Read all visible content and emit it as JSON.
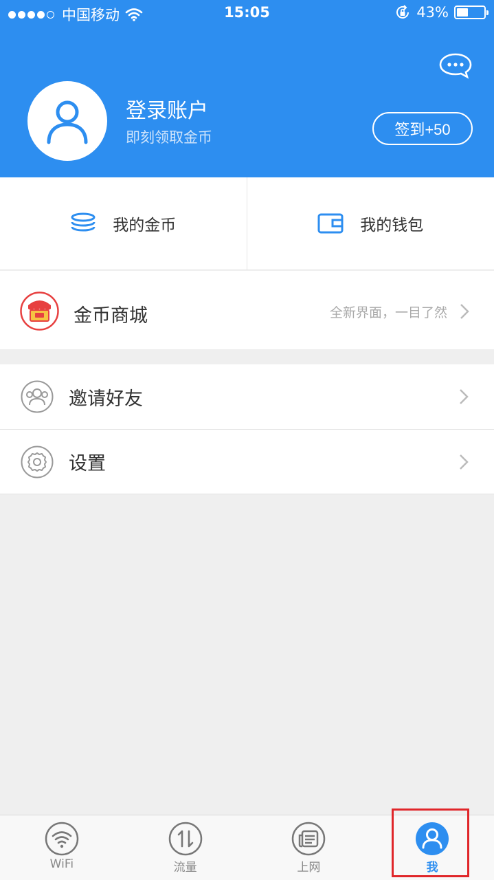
{
  "status_bar": {
    "carrier": "中国移动",
    "time": "15:05",
    "battery": "43%",
    "battery_level": 0.43
  },
  "profile": {
    "title": "登录账户",
    "subtitle": "即刻领取金币",
    "checkin_label": "签到+50"
  },
  "quick_actions": {
    "coins_label": "我的金币",
    "wallet_label": "我的钱包"
  },
  "mall": {
    "label": "金币商城",
    "hint": "全新界面，一目了然"
  },
  "menu": {
    "invite_label": "邀请好友",
    "settings_label": "设置"
  },
  "tabs": [
    {
      "label": "WiFi",
      "icon": "wifi-icon"
    },
    {
      "label": "流量",
      "icon": "traffic-icon"
    },
    {
      "label": "上网",
      "icon": "browse-icon"
    },
    {
      "label": "我",
      "icon": "me-icon"
    }
  ],
  "colors": {
    "brand": "#2d8ef0",
    "highlight": "#e0262a"
  }
}
